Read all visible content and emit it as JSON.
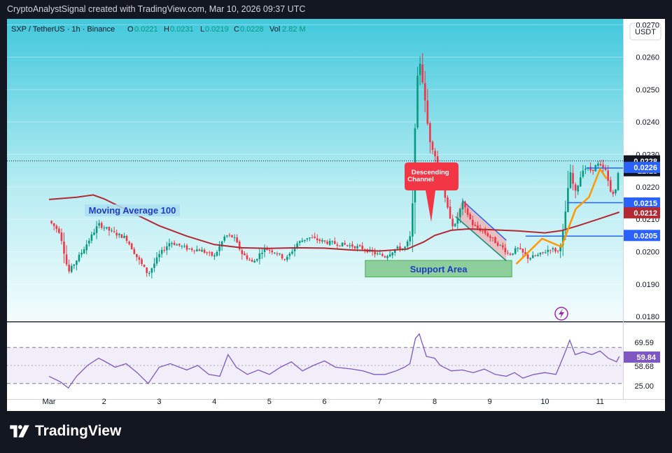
{
  "caption": "CryptoAnalystSignal created with TradingView.com, Mar 10, 2026 09:37 UTC",
  "brand": {
    "name": "TradingView"
  },
  "colors": {
    "bull": "#089981",
    "bear": "#f23645",
    "ma": "#b22833",
    "rsi": "#7e57c2",
    "blue": "#2962ff",
    "orange": "#ff9800",
    "support": "#4caf50"
  },
  "chart_data": {
    "type": "candlestick",
    "symbol": "SXP / TetherUS · 1h · Binance",
    "ohlc": {
      "o_label": "O",
      "o": "0.0221",
      "h_label": "H",
      "h": "0.0231",
      "l_label": "L",
      "l": "0.0219",
      "c_label": "C",
      "c": "0.0228",
      "vol_label": "Vol",
      "vol": "2.82 M"
    },
    "currency": "USDT",
    "price_axis": {
      "ticks": [
        "0.0270",
        "0.0260",
        "0.0250",
        "0.0240",
        "0.0230",
        "0.0220",
        "0.0210",
        "0.0200",
        "0.0190",
        "0.0180"
      ],
      "range": [
        0.01785,
        0.02718
      ]
    },
    "time_axis": {
      "ticks": [
        "Mar",
        "2",
        "3",
        "4",
        "5",
        "6",
        "7",
        "8",
        "9",
        "10",
        "11"
      ],
      "range": [
        0,
        10.9
      ]
    },
    "last_price": {
      "value": "0.0228",
      "countdown": "22:13"
    },
    "price_tags": [
      {
        "value": "0.0226",
        "color": "#2962ff"
      },
      {
        "value": "0.0215",
        "color": "#2962ff"
      },
      {
        "value": "0.0212",
        "color": "#b22833"
      },
      {
        "value": "0.0205",
        "color": "#2962ff"
      }
    ],
    "horizontal_levels": [
      {
        "price": 0.02258,
        "from": 9.75,
        "to": 10.9
      },
      {
        "price": 0.02151,
        "from": 9.4,
        "to": 10.9
      },
      {
        "price": 0.02048,
        "from": 8.65,
        "to": 10.9
      }
    ],
    "annotations": {
      "moving_average": "Moving Average 100",
      "descending_channel": "Descending Channel",
      "support_area": "Support Area"
    },
    "support_zone": {
      "x": [
        5.74,
        8.4
      ],
      "price": [
        0.01922,
        0.01973
      ]
    },
    "channel": {
      "upper": [
        [
          7.5,
          0.02158
        ],
        [
          8.3,
          0.02035
        ]
      ],
      "lower": [
        [
          7.38,
          0.02108
        ],
        [
          8.3,
          0.01972
        ]
      ]
    },
    "ma100": [
      [
        0,
        0.02161
      ],
      [
        0.5,
        0.02168
      ],
      [
        0.8,
        0.02175
      ],
      [
        1.0,
        0.02163
      ],
      [
        1.5,
        0.02121
      ],
      [
        2.0,
        0.0208
      ],
      [
        2.5,
        0.02048
      ],
      [
        3.0,
        0.02022
      ],
      [
        3.5,
        0.02012
      ],
      [
        4.0,
        0.0201
      ],
      [
        4.5,
        0.02012
      ],
      [
        5.0,
        0.02011
      ],
      [
        5.5,
        0.02005
      ],
      [
        6.0,
        0.02002
      ],
      [
        6.5,
        0.02008
      ],
      [
        6.8,
        0.0203
      ],
      [
        7.0,
        0.0205
      ],
      [
        7.3,
        0.02066
      ],
      [
        7.6,
        0.0207
      ],
      [
        8.0,
        0.02068
      ],
      [
        8.5,
        0.02064
      ],
      [
        9.0,
        0.02058
      ],
      [
        9.3,
        0.02065
      ],
      [
        9.6,
        0.0208
      ],
      [
        10.0,
        0.02102
      ],
      [
        10.35,
        0.02122
      ]
    ],
    "projection_path": [
      [
        8.48,
        0.01962
      ],
      [
        8.95,
        0.0204
      ],
      [
        9.3,
        0.02015
      ],
      [
        9.56,
        0.02132
      ],
      [
        9.8,
        0.02168
      ],
      [
        10.0,
        0.02255
      ],
      [
        10.12,
        0.02225
      ]
    ],
    "price_series": [
      [
        0,
        0.02095
      ],
      [
        0.2,
        0.0206
      ],
      [
        0.35,
        0.01935
      ],
      [
        0.6,
        0.02
      ],
      [
        0.9,
        0.02085
      ],
      [
        1.15,
        0.0206
      ],
      [
        1.4,
        0.02042
      ],
      [
        1.6,
        0.01982
      ],
      [
        1.8,
        0.0193
      ],
      [
        2.0,
        0.0199
      ],
      [
        2.2,
        0.0203
      ],
      [
        2.5,
        0.0201
      ],
      [
        2.75,
        0.02005
      ],
      [
        3.0,
        0.01985
      ],
      [
        3.2,
        0.0205
      ],
      [
        3.35,
        0.02045
      ],
      [
        3.5,
        0.01995
      ],
      [
        3.7,
        0.01965
      ],
      [
        3.9,
        0.0201
      ],
      [
        4.1,
        0.02
      ],
      [
        4.3,
        0.01975
      ],
      [
        4.5,
        0.02025
      ],
      [
        4.7,
        0.02045
      ],
      [
        5.0,
        0.0203
      ],
      [
        5.2,
        0.02025
      ],
      [
        5.5,
        0.02018
      ],
      [
        5.7,
        0.0201
      ],
      [
        5.9,
        0.01995
      ],
      [
        6.1,
        0.01985
      ],
      [
        6.3,
        0.0201
      ],
      [
        6.45,
        0.0201
      ],
      [
        6.55,
        0.0204
      ],
      [
        6.6,
        0.0215
      ],
      [
        6.66,
        0.0248
      ],
      [
        6.72,
        0.026
      ],
      [
        6.8,
        0.025
      ],
      [
        6.9,
        0.0235
      ],
      [
        7.0,
        0.023
      ],
      [
        7.1,
        0.0225
      ],
      [
        7.2,
        0.0215
      ],
      [
        7.35,
        0.0207
      ],
      [
        7.5,
        0.0215
      ],
      [
        7.7,
        0.0208
      ],
      [
        7.9,
        0.0206
      ],
      [
        8.1,
        0.0203
      ],
      [
        8.25,
        0.0201
      ],
      [
        8.35,
        0.0199
      ],
      [
        8.5,
        0.0201
      ],
      [
        8.7,
        0.0198
      ],
      [
        8.9,
        0.0199
      ],
      [
        9.1,
        0.0201
      ],
      [
        9.25,
        0.02
      ],
      [
        9.35,
        0.0208
      ],
      [
        9.45,
        0.0225
      ],
      [
        9.55,
        0.0218
      ],
      [
        9.7,
        0.0226
      ],
      [
        9.85,
        0.0225
      ],
      [
        9.95,
        0.0227
      ],
      [
        10.1,
        0.0225
      ],
      [
        10.2,
        0.0218
      ],
      [
        10.3,
        0.0219
      ],
      [
        10.35,
        0.0228
      ]
    ],
    "rsi": {
      "ticks": [
        "69.59",
        "58.68",
        "25.00"
      ],
      "value": "59.84",
      "band": [
        30,
        70
      ],
      "series": [
        [
          0,
          38
        ],
        [
          0.2,
          32
        ],
        [
          0.35,
          25
        ],
        [
          0.5,
          38
        ],
        [
          0.7,
          50
        ],
        [
          0.9,
          58
        ],
        [
          1.0,
          55
        ],
        [
          1.2,
          48
        ],
        [
          1.4,
          52
        ],
        [
          1.6,
          42
        ],
        [
          1.8,
          30
        ],
        [
          2.0,
          48
        ],
        [
          2.2,
          52
        ],
        [
          2.5,
          45
        ],
        [
          2.7,
          50
        ],
        [
          2.9,
          40
        ],
        [
          3.1,
          38
        ],
        [
          3.25,
          62
        ],
        [
          3.4,
          48
        ],
        [
          3.6,
          40
        ],
        [
          3.8,
          45
        ],
        [
          4.0,
          40
        ],
        [
          4.2,
          48
        ],
        [
          4.4,
          54
        ],
        [
          4.6,
          44
        ],
        [
          4.8,
          50
        ],
        [
          5.0,
          55
        ],
        [
          5.2,
          48
        ],
        [
          5.5,
          46
        ],
        [
          5.7,
          44
        ],
        [
          5.9,
          40
        ],
        [
          6.1,
          40
        ],
        [
          6.3,
          44
        ],
        [
          6.45,
          48
        ],
        [
          6.55,
          52
        ],
        [
          6.65,
          80
        ],
        [
          6.72,
          85
        ],
        [
          6.85,
          60
        ],
        [
          7.0,
          58
        ],
        [
          7.1,
          50
        ],
        [
          7.3,
          44
        ],
        [
          7.5,
          45
        ],
        [
          7.7,
          42
        ],
        [
          7.9,
          46
        ],
        [
          8.1,
          40
        ],
        [
          8.3,
          38
        ],
        [
          8.45,
          42
        ],
        [
          8.6,
          36
        ],
        [
          8.8,
          40
        ],
        [
          9.0,
          42
        ],
        [
          9.2,
          40
        ],
        [
          9.35,
          62
        ],
        [
          9.45,
          78
        ],
        [
          9.55,
          62
        ],
        [
          9.7,
          65
        ],
        [
          9.85,
          62
        ],
        [
          10.0,
          66
        ],
        [
          10.15,
          58
        ],
        [
          10.3,
          54
        ],
        [
          10.35,
          60
        ]
      ]
    }
  }
}
